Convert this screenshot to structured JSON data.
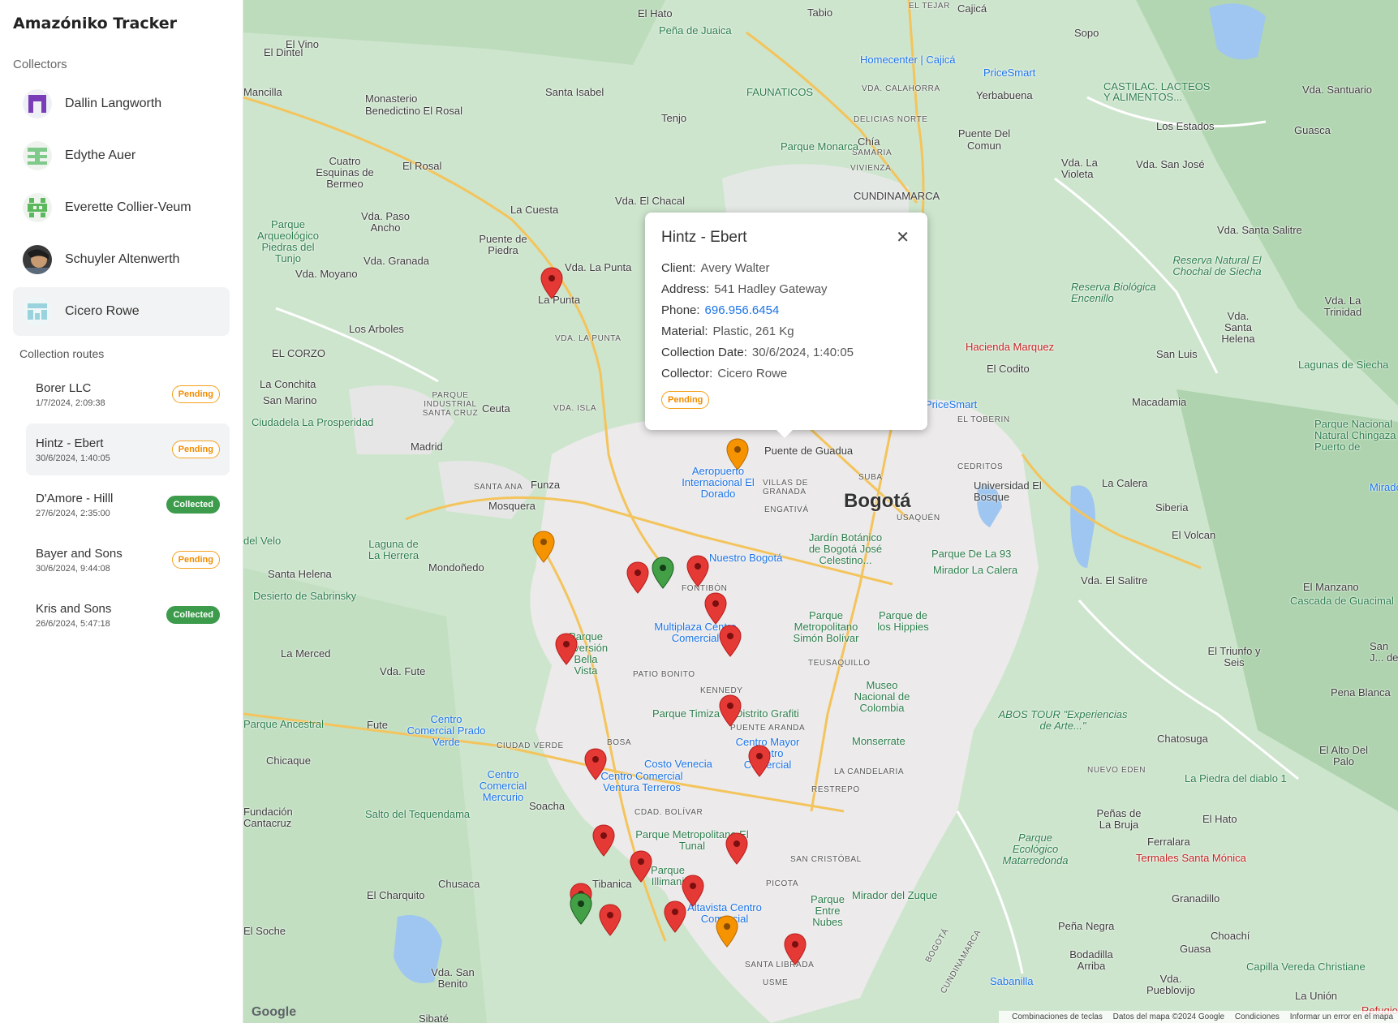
{
  "app": {
    "title": "Amazóniko Tracker"
  },
  "sidebar": {
    "collectors_label": "Collectors",
    "collectors": [
      {
        "name": "Dallin Langworth",
        "active": false
      },
      {
        "name": "Edythe Auer",
        "active": false
      },
      {
        "name": "Everette Collier-Veum",
        "active": false
      },
      {
        "name": "Schuyler Altenwerth",
        "active": false
      },
      {
        "name": "Cicero Rowe",
        "active": true
      }
    ],
    "routes_label": "Collection routes",
    "routes": [
      {
        "title": "Borer LLC",
        "date": "1/7/2024, 2:09:38",
        "status": "Pending"
      },
      {
        "title": "Hintz - Ebert",
        "date": "30/6/2024, 1:40:05",
        "status": "Pending",
        "active": true
      },
      {
        "title": "D'Amore - Hilll",
        "date": "27/6/2024, 2:35:00",
        "status": "Collected"
      },
      {
        "title": "Bayer and Sons",
        "date": "30/6/2024, 9:44:08",
        "status": "Pending"
      },
      {
        "title": "Kris and Sons",
        "date": "26/6/2024, 5:47:18",
        "status": "Collected"
      }
    ]
  },
  "popup": {
    "title": "Hintz - Ebert",
    "close_icon": "close-icon",
    "client_label": "Client:",
    "client": "Avery Walter",
    "address_label": "Address:",
    "address": "541 Hadley Gateway",
    "phone_label": "Phone:",
    "phone": "696.956.6454",
    "material_label": "Material:",
    "material": "Plastic, 261 Kg",
    "date_label": "Collection Date:",
    "date": "30/6/2024, 1:40:05",
    "collector_label": "Collector:",
    "collector": "Cicero Rowe",
    "status": "Pending"
  },
  "map": {
    "places": {
      "el_hato": "El Hato",
      "tabio": "Tabio",
      "el_tejar": "EL TEJAR",
      "cajica": "Cajicá",
      "pena_juaica": "Peña de Juaica",
      "sopo": "Sopo",
      "el_dintel": "El Dintel",
      "el_vino": "El Vino",
      "homecenter": "Homecenter | Cajicá",
      "pricesmart": "PriceSmart",
      "mancilla": "Mancilla",
      "santa_isabel": "Santa Isabel",
      "faunaticos": "FAUNATICOS",
      "vda_calahorra": "VDA. CALAHORRA",
      "yerbabuena": "Yerbabuena",
      "castilac": "CASTILAC. LACTEOS Y ALIMENTOS...",
      "vda_santuario": "Vda. Santuario",
      "monasterio": "Monasterio Benedictino El Rosal",
      "tenjo": "Tenjo",
      "delicias_norte": "DELICIAS NORTE",
      "chia": "Chía",
      "samaria": "SAMARIA",
      "puente_del_comun": "Puente Del Comun",
      "los_estados": "Los Estados",
      "guasca": "Guasca",
      "parque_monarca": "Parque Monarca",
      "cuatro_esquinas": "Cuatro Esquinas de Bermeo",
      "el_rosal": "El Rosal",
      "viviensa": "VIVIENZA",
      "cundinamarca": "CUNDINAMARCA",
      "vda_la_violeta": "Vda. La Violeta",
      "vda_san_jose": "Vda. San José",
      "vda_el_chacal": "Vda. El Chacal",
      "la_cuesta": "La Cuesta",
      "vda_paso_ancho": "Vda. Paso Ancho",
      "puente_piedra": "Puente de Piedra",
      "parque_arqueologico": "Parque Arqueológico Piedras del Tunjo",
      "vda_granada": "Vda. Granada",
      "vda_la_punta": "Vda. La Punta",
      "la_punta": "La Punta",
      "vda_moyano": "Vda. Moyano",
      "vda_santa_salitre": "Vda. Santa Salitre",
      "reserva_chochal": "Reserva Natural El Chochal de Siecha",
      "reserva_encenillo": "Reserva Biológica Encenillo",
      "los_arboles": "Los Arboles",
      "vda_la_punta_small": "VDA. LA PUNTA",
      "el_corzo": "EL CORZO",
      "hacienda_marquez": "Hacienda Marquez",
      "el_codito": "El Codito",
      "vda_la_trinidad": "Vda. La Trinidad",
      "vda_santa_helena": "Vda. Santa Helena",
      "san_luis": "San Luis",
      "lagunas_siecha": "Lagunas de Siecha",
      "la_conchita": "La Conchita",
      "san_marino": "San Marino",
      "pricesmart2": "PriceSmart",
      "el_toberin": "EL TOBERIN",
      "parque_industrial": "PARQUE INDUSTRIAL SANTA CRUZ",
      "ceuta": "Ceuta",
      "vda_isla": "VDA. ISLA",
      "macadamia": "Macadamia",
      "ciudadela": "Ciudadela La Prosperidad",
      "madrid": "Madrid",
      "cedritos": "CEDRITOS",
      "parque_chingaza": "Parque Nacional Natural Chingaza - Puerto de",
      "aeropuerto": "Aeropuerto Internacional El Dorado",
      "villas_granada": "VILLAS DE GRANADA",
      "puente_guadua": "Puente de Guadua",
      "suba": "SUBA",
      "bogota": "Bogotá",
      "universidad_bosque": "Universidad El Bosque",
      "la_calera": "La Calera",
      "santa_ana": "SANTA ANA",
      "funza": "Funza",
      "mosquera": "Mosquera",
      "engativa": "ENGATIVÁ",
      "usaquen": "USAQUÉN",
      "siberia": "Siberia",
      "mirador": "Mirador",
      "el_volcan": "El Volcan",
      "del_velo": "del Velo",
      "laguna_herrera": "Laguna de La Herrera",
      "mondonedo": "Mondoñedo",
      "nuestro_bogota": "Nuestro Bogotá",
      "jardin_botanico": "Jardín Botánico de Bogotá José Celestino...",
      "parque_la_93": "Parque De La 93",
      "mirador_calera": "Mirador La Calera",
      "vda_el_salitre": "Vda. El Salitre",
      "el_manzano": "El Manzano",
      "cascada_guacimal": "Cascada de Guacimal",
      "santa_helena": "Santa Helena",
      "desierto_sabrinsky": "Desierto de Sabrinsky",
      "fontibon": "FONTIBÓN",
      "parque_metropolitano_bolivar": "Parque Metropolitano Simón Bolívar",
      "parque_hippies": "Parque de los Hippies",
      "multiplaza": "Multiplaza Centro Comercial",
      "parque_diversion": "Parque Diversión Bella Vista",
      "la_merced": "La Merced",
      "vda_fute": "Vda. Fute",
      "patio_bonito": "PATIO BONITO",
      "teusaquillo": "TEUSAQUILLO",
      "museo_nacional": "Museo Nacional de Colombia",
      "kennedy": "KENNEDY",
      "el_triunfo": "El Triunfo y Seis",
      "pena_blanca": "Pena Blanca",
      "san_j": "San J... de",
      "parque_ancestral": "Parque Ancestral",
      "fute": "Fute",
      "prado_verde": "Centro Comercial Prado Verde",
      "parque_timiza": "Parque Timiza",
      "distrito_grafiti": "Distrito Grafiti",
      "puente_aranda": "PUENTE ARANDA",
      "abos_tour": "ABOS TOUR \"Experiencias de Arte...\"",
      "chatosuga": "Chatosuga",
      "ciudad_verde": "CIUDAD VERDE",
      "bosa": "BOSA",
      "centro_mayor": "Centro Mayor Centro Comercial",
      "monserrate": "Monserrate",
      "el_alto_palo": "El Alto Del Palo",
      "chicaque": "Chicaque",
      "costo_venecia": "Costo Venecia",
      "la_candelaria": "LA CANDELARIA",
      "nuevo_eden": "NUEVO EDEN",
      "centro_mercurio": "Centro Comercial Mercurio",
      "centro_ventura": "Centro Comercial Ventura Terreros",
      "restrepo": "RESTREPO",
      "piedra_diablo": "La Piedra del diablo 1",
      "fundacion": "Fundación Cantacruz",
      "salto_tequendama": "Salto del Tequendama",
      "soacha": "Soacha",
      "cdad_bolivar": "CDAD. BOLÍVAR",
      "penas_bruja": "Peñas de La Bruja",
      "el_hato2": "El Hato",
      "parque_tunal": "Parque Metropolitano El Tunal",
      "parque_matarredonda": "Parque Ecológico Matarredonda",
      "ferralara": "Ferralara",
      "san_cristobal": "SAN CRISTÓBAL",
      "termales": "Termales Santa Mónica",
      "tibacuy": "Tibanica",
      "parque_illimani": "Parque Illimani",
      "chusaca": "Chusaca",
      "el_charquito": "El Charquito",
      "picota": "PICOTA",
      "mirador_zuque": "Mirador del Zuque",
      "granadillo": "Granadillo",
      "altavista": "Altavista Centro Comercial",
      "parque_entre_nubes": "Parque Entre Nubes",
      "pena_negra": "Peña Negra",
      "choachi": "Choachí",
      "el_soche": "El Soche",
      "bogota_river": "BOGOTÁ",
      "cundinamarca2": "CUNDINAMARCA",
      "boquerón": "Bodadilla Arriba",
      "guasa": "Guasa",
      "capilla_vereda": "Capilla Vereda Christiane",
      "vda_pueblovijo": "Vda. Pueblovijo",
      "santa_librada": "SANTA LIBRADA",
      "vda_san_benito": "Vda. San Benito",
      "sabanilla": "Sabanilla",
      "usme": "USME",
      "la_union": "La Unión",
      "refugio": "Refugio del",
      "sibate": "Sibaté"
    },
    "footer": {
      "shortcuts": "Combinaciones de teclas",
      "data": "Datos del mapa ©2024 Google",
      "terms": "Condiciones",
      "report": "Informar un error en el mapa"
    },
    "logo": "Google"
  }
}
